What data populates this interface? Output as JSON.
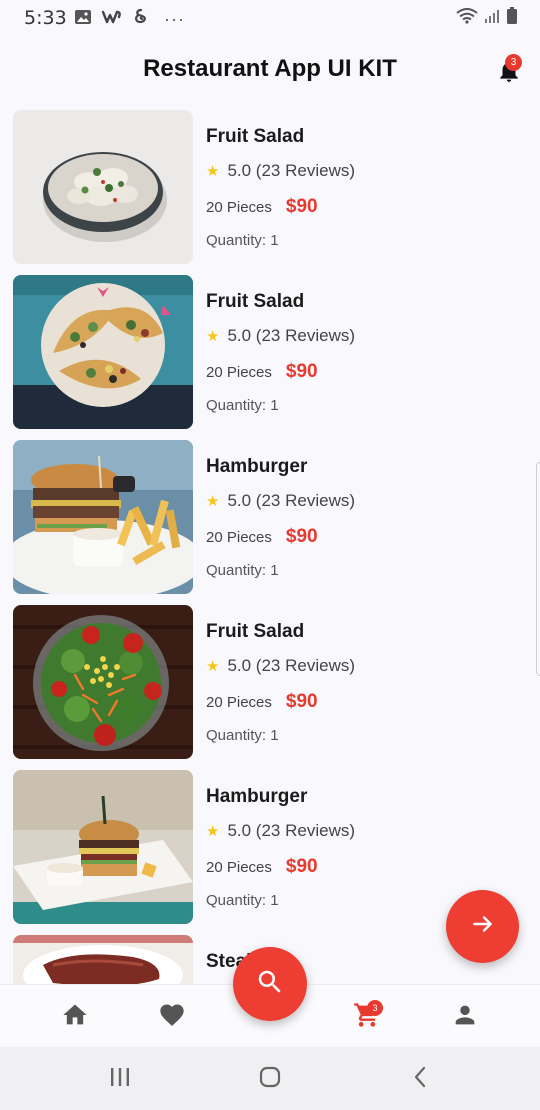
{
  "status_bar": {
    "time": "5:33",
    "more": "···"
  },
  "header": {
    "title": "Restaurant App UI KIT",
    "notification_count": "3"
  },
  "items": [
    {
      "name": "Fruit Salad",
      "rating": "5.0 (23 Reviews)",
      "pieces": "20 Pieces",
      "price": "$90",
      "quantity": "Quantity: 1",
      "image": "dumplings-bowl"
    },
    {
      "name": "Fruit Salad",
      "rating": "5.0 (23 Reviews)",
      "pieces": "20 Pieces",
      "price": "$90",
      "quantity": "Quantity: 1",
      "image": "tacos-plate"
    },
    {
      "name": "Hamburger",
      "rating": "5.0 (23 Reviews)",
      "pieces": "20 Pieces",
      "price": "$90",
      "quantity": "Quantity: 1",
      "image": "burger-fries"
    },
    {
      "name": "Fruit Salad",
      "rating": "5.0 (23 Reviews)",
      "pieces": "20 Pieces",
      "price": "$90",
      "quantity": "Quantity: 1",
      "image": "salad-bowl"
    },
    {
      "name": "Hamburger",
      "rating": "5.0 (23 Reviews)",
      "pieces": "20 Pieces",
      "price": "$90",
      "quantity": "Quantity: 1",
      "image": "burger-plate"
    },
    {
      "name": "Steak",
      "rating": "",
      "pieces": "",
      "price": "",
      "quantity": "",
      "image": "steak"
    }
  ],
  "bottom_nav": {
    "items": [
      "home-icon",
      "heart-icon",
      "search-icon",
      "cart-icon",
      "person-icon"
    ],
    "cart_count": "3"
  },
  "colors": {
    "accent": "#ee3e33",
    "star": "#f5c518",
    "background": "#f9f9fd"
  }
}
